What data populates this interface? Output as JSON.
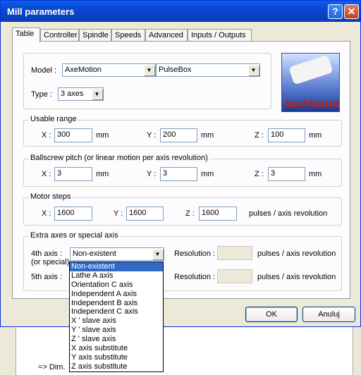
{
  "window": {
    "title": "Mill parameters"
  },
  "tabs": [
    "Table",
    "Controller",
    "Spindle",
    "Speeds",
    "Advanced",
    "Inputs / Outputs"
  ],
  "model": {
    "label": "Model :",
    "value": "AxeMotion",
    "value2": "PulseBox"
  },
  "type": {
    "label": "Type :",
    "value": "3 axes"
  },
  "logo": {
    "text": "AxeMotion"
  },
  "usable_range": {
    "title": "Usable range",
    "x_label": "X :",
    "x_value": "300",
    "y_label": "Y :",
    "y_value": "200",
    "z_label": "Z :",
    "z_value": "100",
    "unit": "mm"
  },
  "ballscrew": {
    "title": "Ballscrew pitch (or linear motion per axis revolution)",
    "x_label": "X :",
    "x_value": "3",
    "y_label": "Y :",
    "y_value": "3",
    "z_label": "Z :",
    "z_value": "3",
    "unit": "mm"
  },
  "motor_steps": {
    "title": "Motor steps",
    "x_label": "X :",
    "x_value": "1600",
    "y_label": "Y :",
    "y_value": "1600",
    "z_label": "Z :",
    "z_value": "1600",
    "unit": "pulses / axis revolution"
  },
  "extra": {
    "title": "Extra axes or special axis",
    "axis4_label": "4th axis :",
    "axis4_sub": "(or special)",
    "axis4_value": "Non-existent",
    "axis5_label": "5th axis :",
    "resolution_label": "Resolution :",
    "unit": "pulses / axis revolution",
    "options": [
      "Non-existent",
      "Lathe A axis",
      "Orientation C axis",
      "Independent A axis",
      "Independent B axis",
      "Independent C axis",
      "X ' slave axis",
      "Y ' slave axis",
      "Z ' slave axis",
      "X axis substitute",
      "Y axis substitute",
      "Z axis substitute"
    ]
  },
  "buttons": {
    "ok": "OK",
    "cancel": "Anuluj"
  },
  "lower": {
    "dim_text": "=> Dim."
  }
}
